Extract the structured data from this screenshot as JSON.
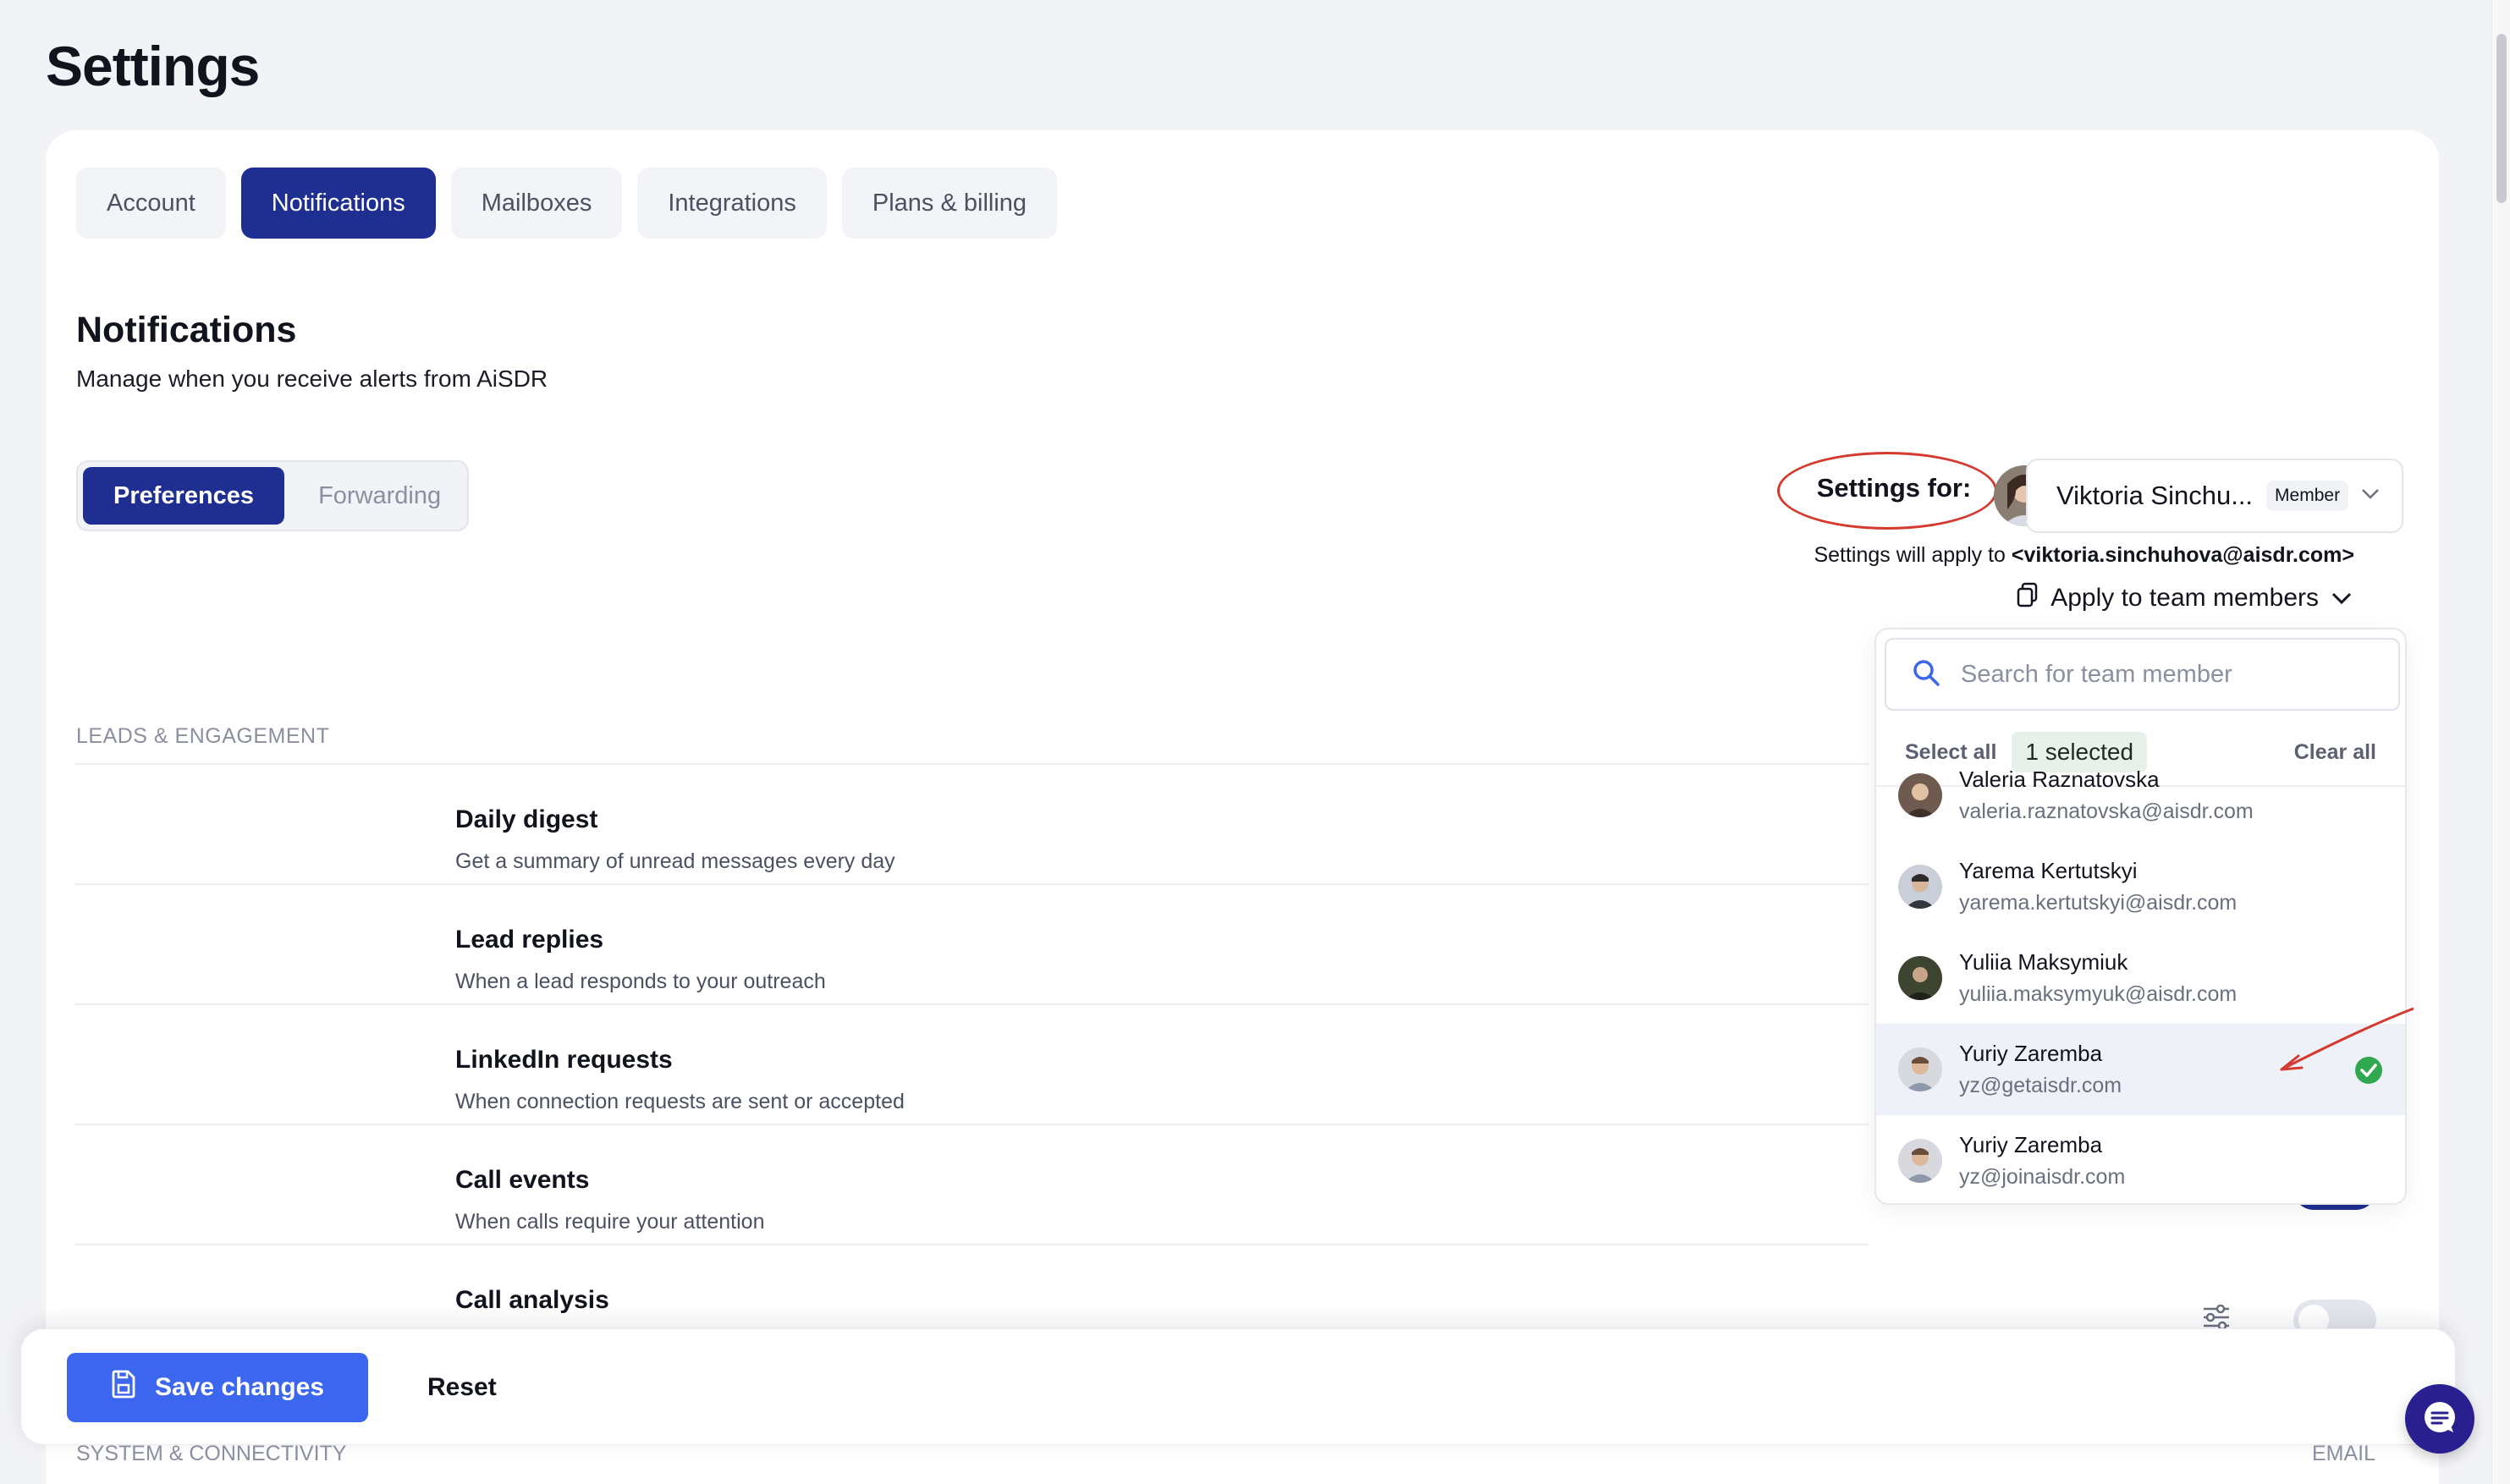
{
  "page": {
    "title": "Settings"
  },
  "tabs": [
    {
      "label": "Account",
      "active": false
    },
    {
      "label": "Notifications",
      "active": true
    },
    {
      "label": "Mailboxes",
      "active": false
    },
    {
      "label": "Integrations",
      "active": false
    },
    {
      "label": "Plans & billing",
      "active": false
    }
  ],
  "section": {
    "title": "Notifications",
    "subtitle": "Manage when you receive alerts from AiSDR"
  },
  "segments": [
    {
      "label": "Preferences",
      "active": true
    },
    {
      "label": "Forwarding",
      "active": false
    }
  ],
  "settings_for": {
    "label": "Settings for:",
    "member_name": "Viktoria Sinchu...",
    "member_role": "Member",
    "apply_prefix": "Settings will apply to",
    "apply_email": "<viktoria.sinchuhova@aisdr.com>",
    "apply_team_label": "Apply to team members"
  },
  "group_label": "LEADS & ENGAGEMENT",
  "notifications": [
    {
      "title": "Daily digest",
      "description": "Get a summary of unread messages every day"
    },
    {
      "title": "Lead replies",
      "description": "When a lead responds to your outreach"
    },
    {
      "title": "LinkedIn requests",
      "description": "When connection requests are sent or accepted"
    },
    {
      "title": "Call events",
      "description": "When calls require your attention"
    },
    {
      "title": "Call analysis",
      "description": ""
    }
  ],
  "dropdown": {
    "search_placeholder": "Search for team member",
    "select_all": "Select all",
    "selected_count": "1 selected",
    "clear_all": "Clear all",
    "members": [
      {
        "name": "Valeria Raznatovska",
        "email": "valeria.raznatovska@aisdr.com",
        "selected": false
      },
      {
        "name": "Yarema Kertutskyi",
        "email": "yarema.kertutskyi@aisdr.com",
        "selected": false
      },
      {
        "name": "Yuliia Maksymiuk",
        "email": "yuliia.maksymyuk@aisdr.com",
        "selected": false
      },
      {
        "name": "Yuriy Zaremba",
        "email": "yz@getaisdr.com",
        "selected": true
      },
      {
        "name": "Yuriy Zaremba",
        "email": "yz@joinaisdr.com",
        "selected": false
      }
    ]
  },
  "footer": {
    "save_label": "Save changes",
    "reset_label": "Reset"
  },
  "next_group": {
    "label": "SYSTEM & CONNECTIVITY",
    "column_label": "EMAIL"
  },
  "colors": {
    "primary": "#1e2e91",
    "save": "#3c66ee",
    "annotation": "#d43a2f",
    "check": "#2fa84f",
    "chat": "#2a1f8f"
  },
  "icons": {
    "search": "search-icon",
    "save": "save-icon",
    "copy": "copy-icon",
    "chevron": "chevron-down-icon",
    "check": "check-circle-icon",
    "filter": "sliders-icon",
    "chat": "chat-icon"
  }
}
